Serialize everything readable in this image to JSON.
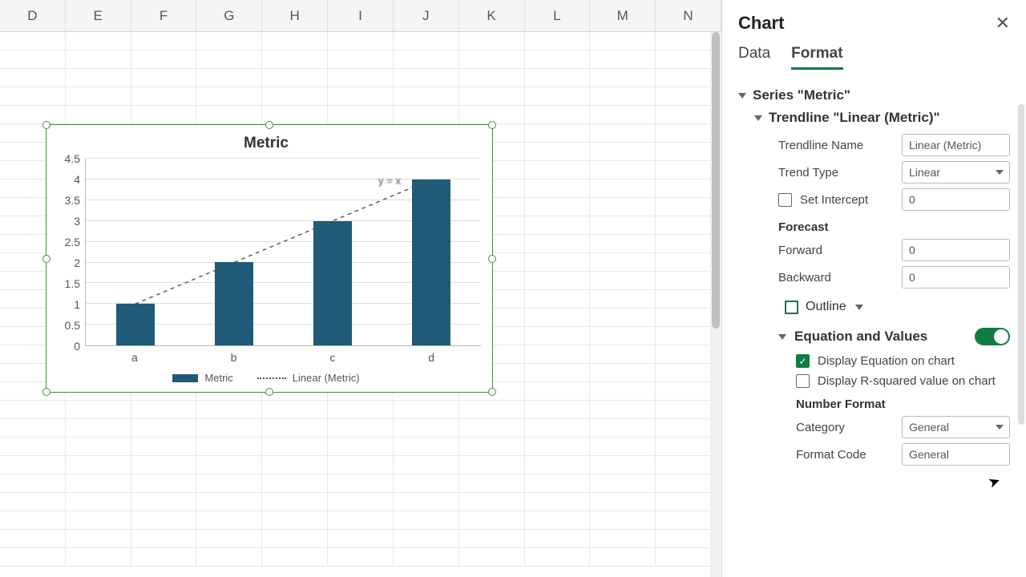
{
  "columns": [
    "D",
    "E",
    "F",
    "G",
    "H",
    "I",
    "J",
    "K",
    "L",
    "M",
    "N"
  ],
  "panel": {
    "title": "Chart",
    "tabs": {
      "data": "Data",
      "format": "Format"
    },
    "series_label": "Series \"Metric\"",
    "trendline_label": "Trendline \"Linear (Metric)\"",
    "trendline_name_label": "Trendline Name",
    "trendline_name_value": "Linear (Metric)",
    "trend_type_label": "Trend Type",
    "trend_type_value": "Linear",
    "set_intercept_label": "Set Intercept",
    "set_intercept_value": "0",
    "forecast_label": "Forecast",
    "forward_label": "Forward",
    "forward_value": "0",
    "backward_label": "Backward",
    "backward_value": "0",
    "outline_label": "Outline",
    "eq_values_label": "Equation and Values",
    "display_eq_label": "Display Equation on chart",
    "display_r2_label": "Display R-squared value on chart",
    "number_format_label": "Number Format",
    "category_label": "Category",
    "category_value": "General",
    "format_code_label": "Format Code",
    "format_code_value": "General"
  },
  "chart_data": {
    "type": "bar",
    "title": "Metric",
    "categories": [
      "a",
      "b",
      "c",
      "d"
    ],
    "values": [
      1,
      2,
      3,
      4
    ],
    "ylim": [
      0,
      4.5
    ],
    "yticks": [
      0,
      0.5,
      1,
      1.5,
      2,
      2.5,
      3,
      3.5,
      4,
      4.5
    ],
    "legend": [
      "Metric",
      "Linear (Metric)"
    ],
    "trendline": {
      "name": "Linear (Metric)",
      "type": "linear"
    },
    "equation_label": "y = x"
  }
}
